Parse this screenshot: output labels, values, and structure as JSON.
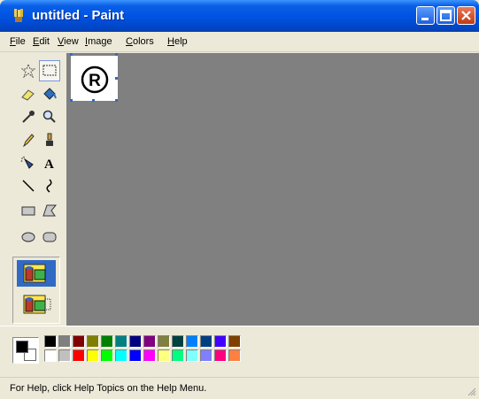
{
  "window": {
    "title": "untitled - Paint",
    "buttons": [
      "minimize",
      "maximize",
      "close"
    ]
  },
  "menu": [
    {
      "underline": "F",
      "rest": "ile"
    },
    {
      "underline": "E",
      "rest": "dit"
    },
    {
      "underline": "V",
      "rest": "iew"
    },
    {
      "underline": "I",
      "rest": "mage"
    },
    {
      "underline": "C",
      "rest": "olors"
    },
    {
      "underline": "H",
      "rest": "elp"
    }
  ],
  "tools": [
    {
      "name": "free-form-select",
      "selected": false
    },
    {
      "name": "select",
      "selected": true
    },
    {
      "name": "eraser",
      "selected": false
    },
    {
      "name": "fill-with-color",
      "selected": false
    },
    {
      "name": "pick-color",
      "selected": false
    },
    {
      "name": "magnifier",
      "selected": false
    },
    {
      "name": "pencil",
      "selected": false
    },
    {
      "name": "brush",
      "selected": false
    },
    {
      "name": "airbrush",
      "selected": false
    },
    {
      "name": "text",
      "selected": false
    },
    {
      "name": "line",
      "selected": false
    },
    {
      "name": "curve",
      "selected": false
    },
    {
      "name": "rectangle",
      "selected": false
    },
    {
      "name": "polygon",
      "selected": false
    },
    {
      "name": "ellipse",
      "selected": false
    },
    {
      "name": "rounded-rectangle",
      "selected": false
    }
  ],
  "tool_options": {
    "selected": "opaque"
  },
  "canvas": {
    "content": "R"
  },
  "colors": {
    "foreground": "#000000",
    "background": "#ffffff",
    "top_row": [
      "#000000",
      "#808080",
      "#800000",
      "#808000",
      "#008000",
      "#008080",
      "#000080",
      "#800080",
      "#808040",
      "#004040",
      "#0080ff",
      "#004080",
      "#4000ff",
      "#804000"
    ],
    "bottom_row": [
      "#ffffff",
      "#c0c0c0",
      "#ff0000",
      "#ffff00",
      "#00ff00",
      "#00ffff",
      "#0000ff",
      "#ff00ff",
      "#ffff80",
      "#00ff80",
      "#80ffff",
      "#8080ff",
      "#ff0080",
      "#ff8040"
    ]
  },
  "status": {
    "text": "For Help, click Help Topics on the Help Menu."
  }
}
